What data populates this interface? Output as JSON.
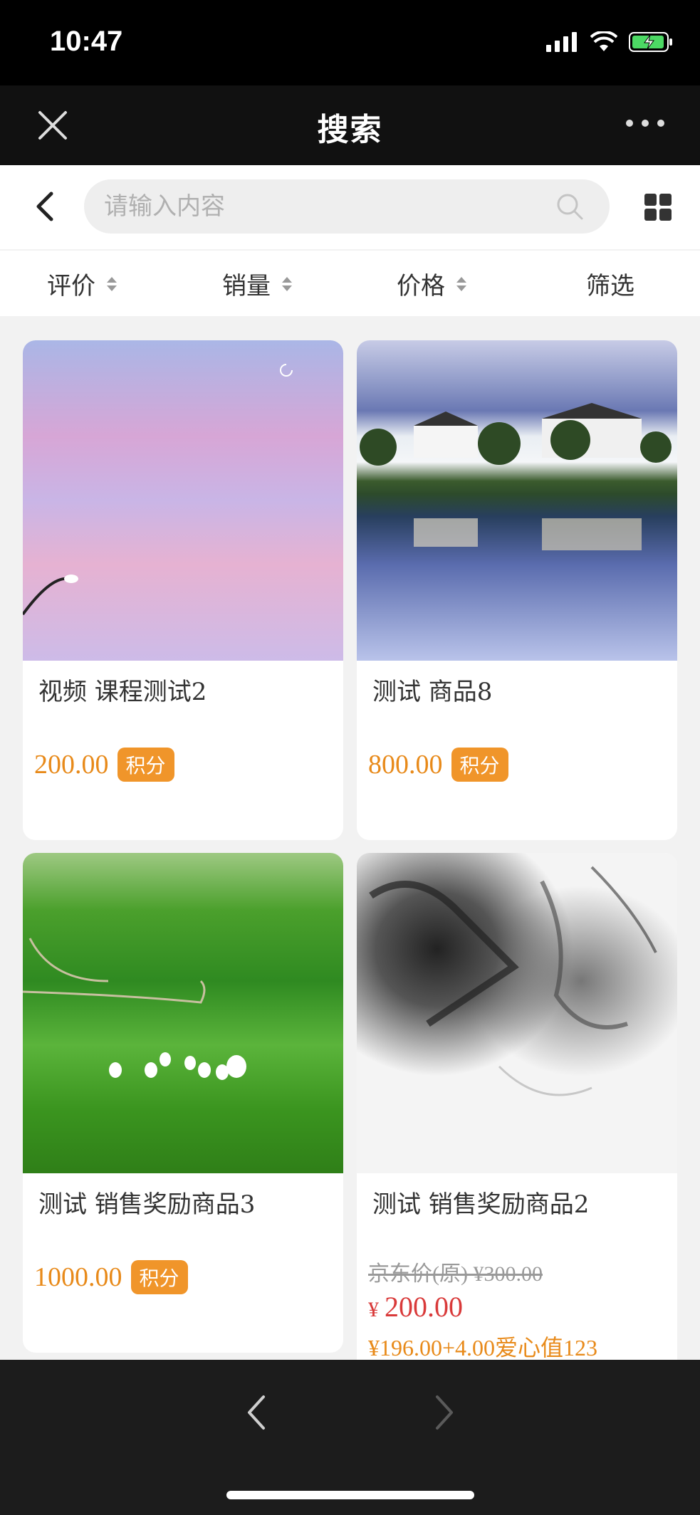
{
  "status_bar": {
    "time": "10:47"
  },
  "title_bar": {
    "title": "搜索"
  },
  "search": {
    "placeholder": "请输入内容",
    "value": ""
  },
  "sort_bar": {
    "items": [
      {
        "label": "评价"
      },
      {
        "label": "销量"
      },
      {
        "label": "价格"
      },
      {
        "label": "筛选"
      }
    ]
  },
  "products": [
    {
      "name": "视频 课程测试2",
      "price": "200.00",
      "badge": "积分",
      "image": "pink-sky-photo"
    },
    {
      "name": "测试 商品8",
      "price": "800.00",
      "badge": "积分",
      "image": "village-lake-photo"
    },
    {
      "name": "测试 销售奖励商品3",
      "price": "1000.00",
      "badge": "积分",
      "image": "grassland-yurt-photo"
    },
    {
      "name": "测试 销售奖励商品2",
      "original_price": "京东价(原) ¥300.00",
      "currency": "¥",
      "price": "200.00",
      "combo_price": "¥196.00+4.00爱心值123",
      "image": "ink-painting-photo"
    }
  ],
  "colors": {
    "accent": "#f0952a",
    "price": "#e88a1a",
    "sale": "#d93a3a"
  }
}
